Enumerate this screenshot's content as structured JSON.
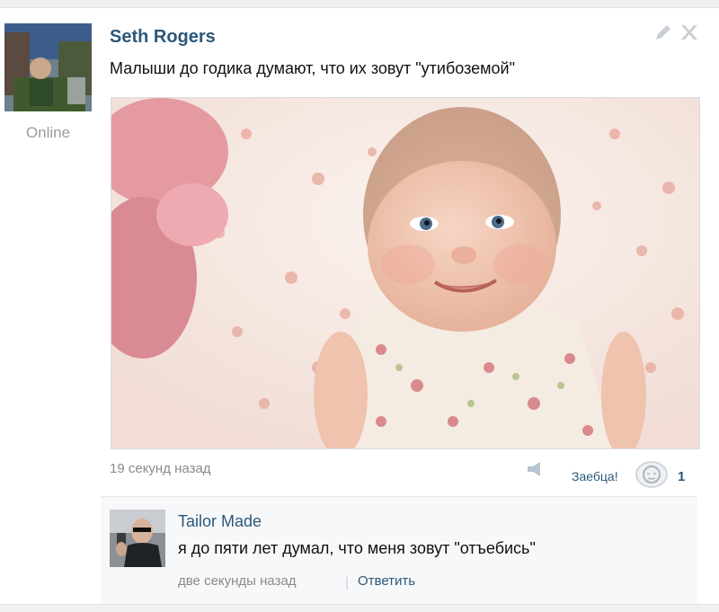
{
  "post": {
    "author": "Seth Rogers",
    "status": "Online",
    "text": "Малыши до годика думают, что их зовут \"утибоземой\"",
    "time": "19 секунд назад",
    "like_label": "Заебца!",
    "like_count": "1",
    "icons": [
      "edit-icon",
      "close-icon",
      "share-icon",
      "like-icon"
    ]
  },
  "comment": {
    "author": "Tailor Made",
    "text": "я до пяти лет думал, что меня зовут \"отъебись\"",
    "time": "две секунды назад",
    "separator": "|",
    "reply_label": "Ответить"
  }
}
